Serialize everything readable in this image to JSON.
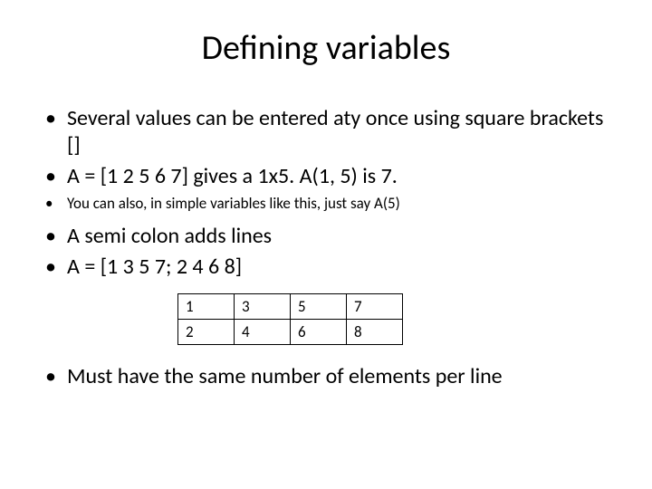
{
  "title": "Defining variables",
  "bullets": {
    "b0": "Several values can be entered aty once using square brackets []",
    "b1": "A = [1 2 5 6 7] gives a 1x5. A(1, 5) is 7.",
    "b2": "You can also, in simple variables like this, just say A(5)",
    "b3": "A semi colon adds lines",
    "b4": "A = [1 3 5 7; 2 4 6 8]",
    "b5": "Must have the same number of elements per line"
  },
  "table": {
    "r0c0": "1",
    "r0c1": "3",
    "r0c2": "5",
    "r0c3": "7",
    "r1c0": "2",
    "r1c1": "4",
    "r1c2": "6",
    "r1c3": "8"
  }
}
